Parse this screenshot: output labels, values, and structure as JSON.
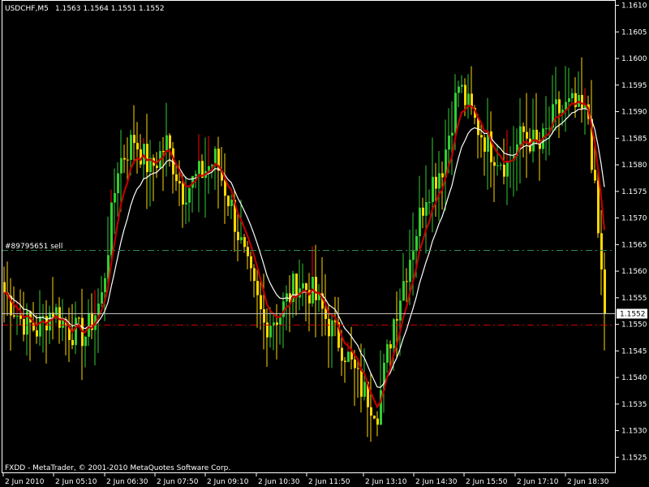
{
  "header": {
    "symbol": "USDCHF,M5",
    "ohlc": "1.1563 1.1564 1.1551 1.1552"
  },
  "footer": {
    "copyright": "FXDD - MetaTrader, © 2001-2010 MetaQuotes Software Corp."
  },
  "colors": {
    "background": "#000000",
    "frame": "#ffffff",
    "bull_candle": "#32cd32",
    "bear_candle": "#ffd700",
    "wick_up_accent": "#ff0000",
    "ma_fast": "#c00000",
    "ma_slow": "#ffffff",
    "order_line": "#2e8b57",
    "stop_line": "#cc0000",
    "bid_line": "#c0c0c0"
  },
  "chart_data": {
    "type": "candlestick",
    "title": "USDCHF,M5",
    "ylim": [
      1.1522,
      1.1611
    ],
    "grid": false,
    "y_ticks": [
      "1.1525",
      "1.1530",
      "1.1535",
      "1.1540",
      "1.1545",
      "1.1550",
      "1.1555",
      "1.1560",
      "1.1565",
      "1.1570",
      "1.1575",
      "1.1580",
      "1.1585",
      "1.1590",
      "1.1595",
      "1.1600",
      "1.1605",
      "1.1610"
    ],
    "x_ticks": [
      "2 Jun 2010",
      "2 Jun 05:10",
      "2 Jun 06:30",
      "2 Jun 07:50",
      "2 Jun 09:10",
      "2 Jun 10:30",
      "2 Jun 11:50",
      "2 Jun 13:10",
      "2 Jun 14:30",
      "2 Jun 15:50",
      "2 Jun 17:10",
      "2 Jun 18:30"
    ],
    "order_line": {
      "label": "#89795651 sell",
      "price": 1.1564
    },
    "stop_line": {
      "price": 1.155
    },
    "bid": {
      "label": "1.1552",
      "price": 1.1552
    },
    "close_path": [
      [
        0,
        1.1556
      ],
      [
        5,
        1.1551
      ],
      [
        10,
        1.1549
      ],
      [
        15,
        1.1553
      ],
      [
        20,
        1.1549
      ],
      [
        25,
        1.1548
      ],
      [
        30,
        1.1555
      ],
      [
        35,
        1.158
      ],
      [
        40,
        1.1585
      ],
      [
        45,
        1.1579
      ],
      [
        50,
        1.1584
      ],
      [
        55,
        1.1575
      ],
      [
        60,
        1.1578
      ],
      [
        65,
        1.1581
      ],
      [
        70,
        1.1572
      ],
      [
        75,
        1.156
      ],
      [
        80,
        1.155
      ],
      [
        85,
        1.1552
      ],
      [
        90,
        1.1558
      ],
      [
        95,
        1.1556
      ],
      [
        100,
        1.155
      ],
      [
        105,
        1.1545
      ],
      [
        110,
        1.1538
      ],
      [
        115,
        1.1534
      ],
      [
        120,
        1.1551
      ],
      [
        125,
        1.1563
      ],
      [
        130,
        1.1575
      ],
      [
        135,
        1.158
      ],
      [
        140,
        1.1595
      ],
      [
        145,
        1.1588
      ],
      [
        150,
        1.1583
      ],
      [
        155,
        1.158
      ],
      [
        160,
        1.1586
      ],
      [
        165,
        1.1583
      ],
      [
        170,
        1.159
      ],
      [
        175,
        1.1591
      ],
      [
        180,
        1.1589
      ],
      [
        185,
        1.1552
      ]
    ]
  }
}
